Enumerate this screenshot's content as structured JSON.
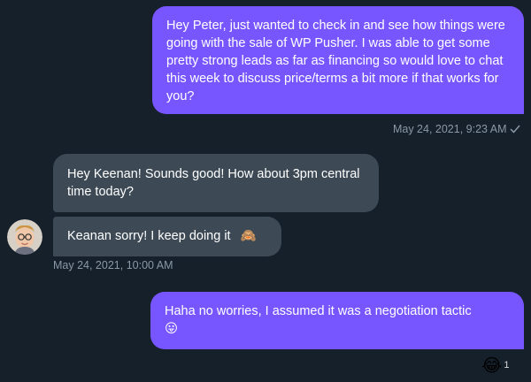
{
  "conversation": {
    "messages": [
      {
        "sender": "self",
        "text": "Hey Peter, just wanted to check in and see how things were going with the sale of WP Pusher. I was able to get some pretty strong leads as far as financing so would love to chat this week to discuss price/terms a bit more if that works for you?",
        "timestamp": "May 24, 2021, 9:23 AM",
        "status_icon": "check-icon"
      },
      {
        "sender": "other",
        "text": "Hey Keenan! Sounds good! How about 3pm central time today?"
      },
      {
        "sender": "other",
        "text": "Keanan sorry! I keep doing it",
        "emoji": "🙈",
        "timestamp": "May 24, 2021, 10:00 AM",
        "avatar_icon": "user-avatar"
      },
      {
        "sender": "self",
        "text": "Haha no worries, I assumed it was a negotiation tactic",
        "emoji": "😛",
        "reaction": {
          "emoji": "😂",
          "count": "1"
        }
      }
    ]
  },
  "colors": {
    "background": "#15202b",
    "sent_bubble": "#7856ff",
    "received_bubble": "#3d4a56",
    "meta_text": "#8b98a5"
  }
}
